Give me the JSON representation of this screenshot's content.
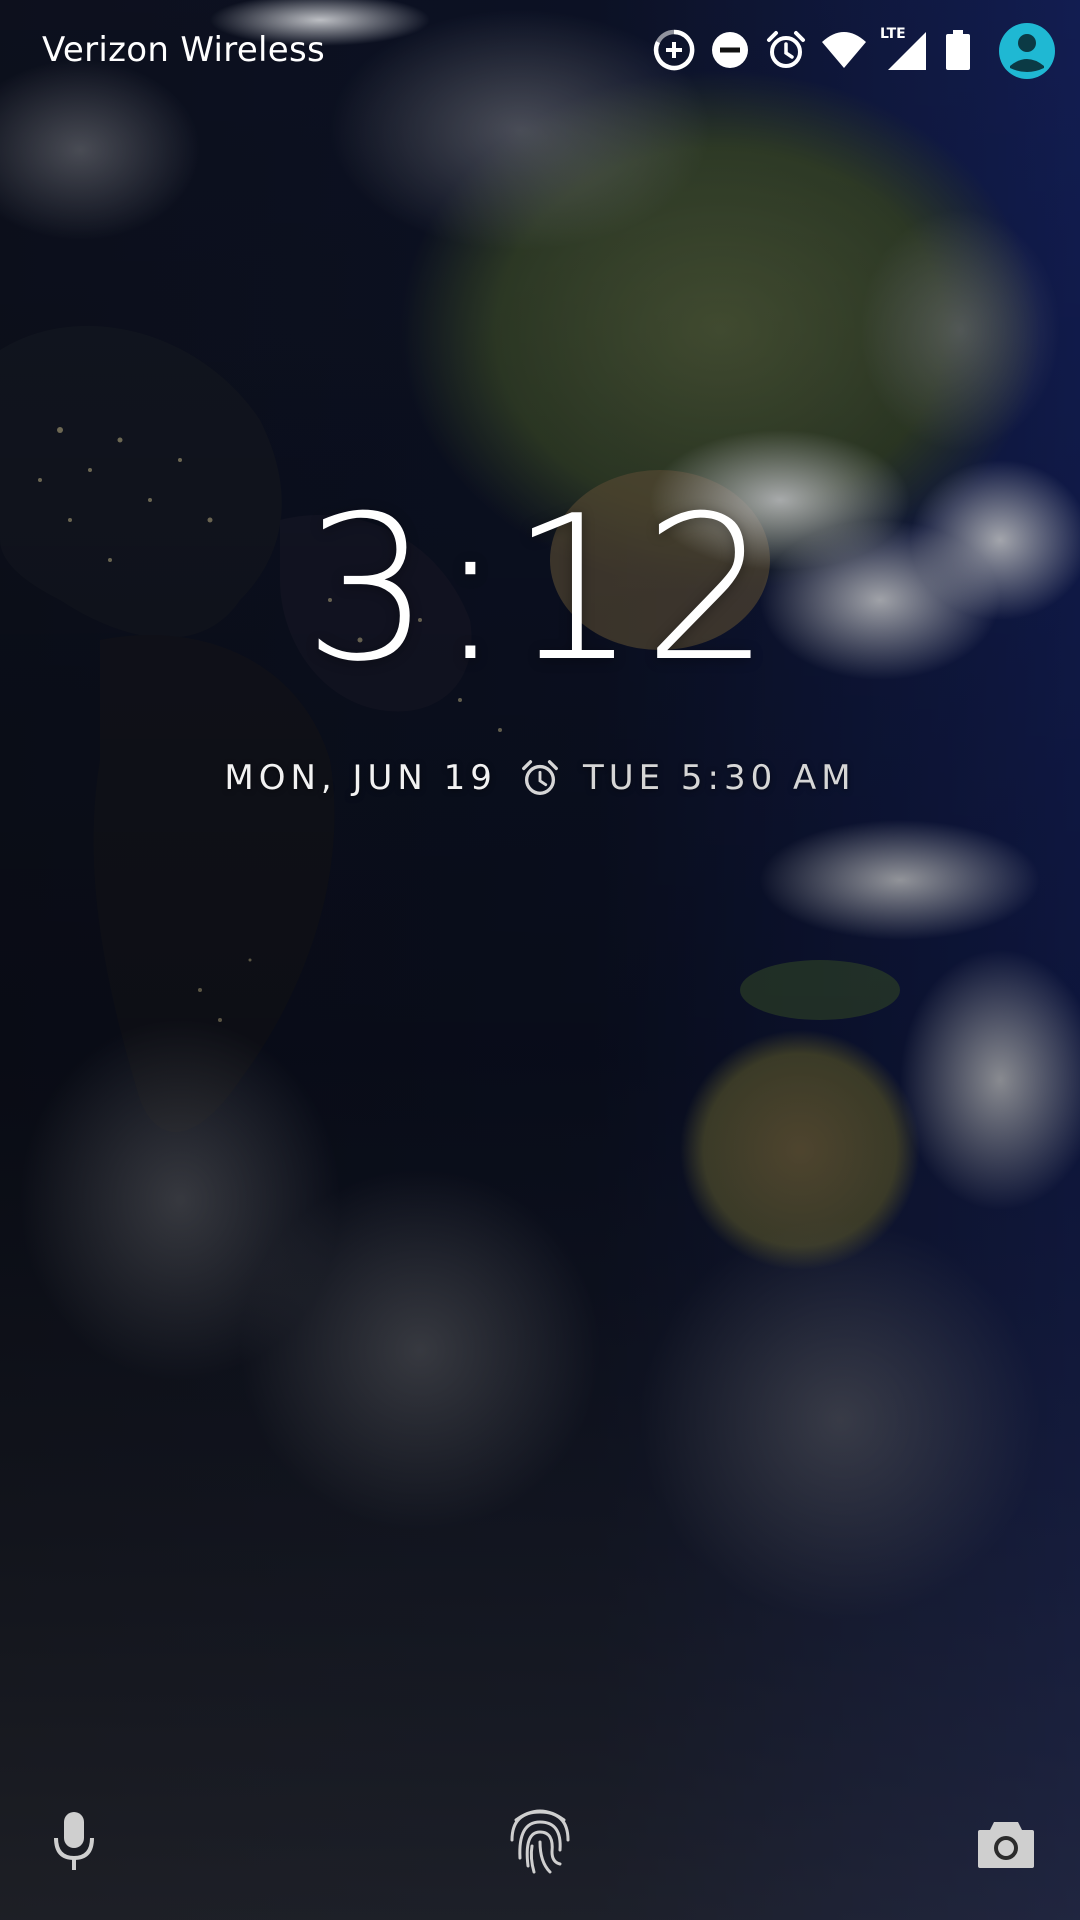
{
  "status_bar": {
    "carrier": "Verizon Wireless",
    "network_type": "LTE",
    "icons": [
      "data-saver-icon",
      "dnd-icon",
      "alarm-icon",
      "wifi-icon",
      "signal-icon",
      "battery-icon",
      "user-avatar-icon"
    ],
    "avatar_color": "#1fb8d3"
  },
  "lockscreen": {
    "time": "3:12",
    "date": "MON, JUN 19",
    "next_alarm": "TUE 5:30 AM"
  },
  "bottom": {
    "icons": [
      "microphone-icon",
      "fingerprint-icon",
      "camera-icon"
    ]
  }
}
